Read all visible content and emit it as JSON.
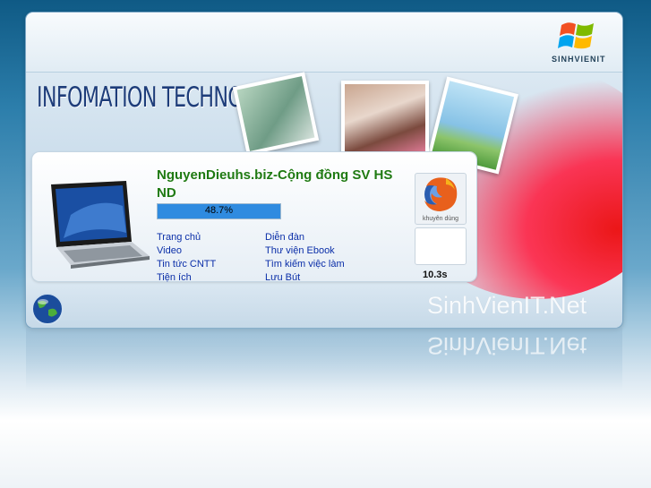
{
  "header": {
    "brand": "SINHVIENIT",
    "hero_title": "INFOMATION TECHNOLOGY"
  },
  "site": {
    "title": "NguyenDieuhs.biz-Cộng đồng SV HS ND",
    "progress_text": "48.7%",
    "progress_value": 0.487
  },
  "links_col1": [
    "Trang chủ",
    "Video",
    "Tin tức CNTT",
    "Tiện ích"
  ],
  "links_col2": [
    "Diễn đàn",
    "Thư viện Ebook",
    "Tìm kiếm việc làm",
    "Lưu Bút"
  ],
  "sidebar": {
    "firefox_caption": "khuyên dùng",
    "timer": "10.3s"
  },
  "footer": {
    "brand": "SinhVienIT.Net"
  },
  "colors": {
    "title_green": "#1f7a12",
    "link_blue": "#0a2ea8",
    "progress_blue": "#2f8be0",
    "hero_navy": "#1e3d7a"
  },
  "icons": [
    "windows-logo-icon",
    "laptop-icon",
    "firefox-icon",
    "globe-icon"
  ]
}
